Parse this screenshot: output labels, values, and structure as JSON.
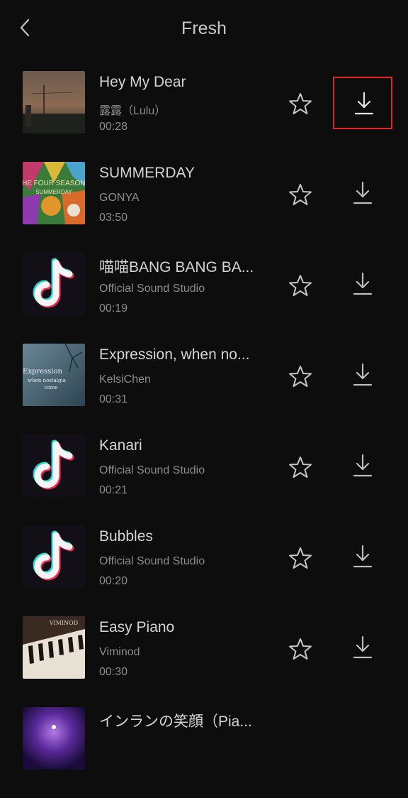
{
  "header": {
    "title": "Fresh"
  },
  "songs": [
    {
      "title": "Hey My Dear",
      "artist": "露露（Lulu）",
      "duration": "00:28",
      "cover": "dusk-photo",
      "download_highlighted": true
    },
    {
      "title": "SUMMERDAY",
      "artist": "GONYA",
      "duration": "03:50",
      "cover": "four-seasons-art",
      "cover_text": [
        "THE FOUR SEASONS",
        "SUMMERDAY"
      ],
      "download_highlighted": false
    },
    {
      "title": "喵喵BANG BANG BA...",
      "artist": "Official Sound Studio",
      "duration": "00:19",
      "cover": "tiktok-logo",
      "download_highlighted": false
    },
    {
      "title": "Expression, when no...",
      "artist": "KelsiChen",
      "duration": "00:31",
      "cover": "expression-art",
      "cover_text": [
        "Expression",
        "when nostalgia",
        "come"
      ],
      "download_highlighted": false
    },
    {
      "title": "Kanari",
      "artist": "Official Sound Studio",
      "duration": "00:21",
      "cover": "tiktok-logo",
      "download_highlighted": false
    },
    {
      "title": "Bubbles",
      "artist": "Official Sound Studio",
      "duration": "00:20",
      "cover": "tiktok-logo",
      "download_highlighted": false
    },
    {
      "title": "Easy Piano",
      "artist": "Viminod",
      "duration": "00:30",
      "cover": "piano-photo",
      "cover_text": [
        "VIMINOD"
      ],
      "download_highlighted": false
    },
    {
      "title": "インランの笑顔（Pia...",
      "artist": "",
      "duration": "",
      "cover": "purple-night-art",
      "download_highlighted": false
    }
  ],
  "icons": {
    "back": "chevron-left-icon",
    "favorite": "star-icon",
    "download": "download-icon"
  },
  "colors": {
    "background": "#0d0d0d",
    "highlight_border": "#e0262a"
  }
}
